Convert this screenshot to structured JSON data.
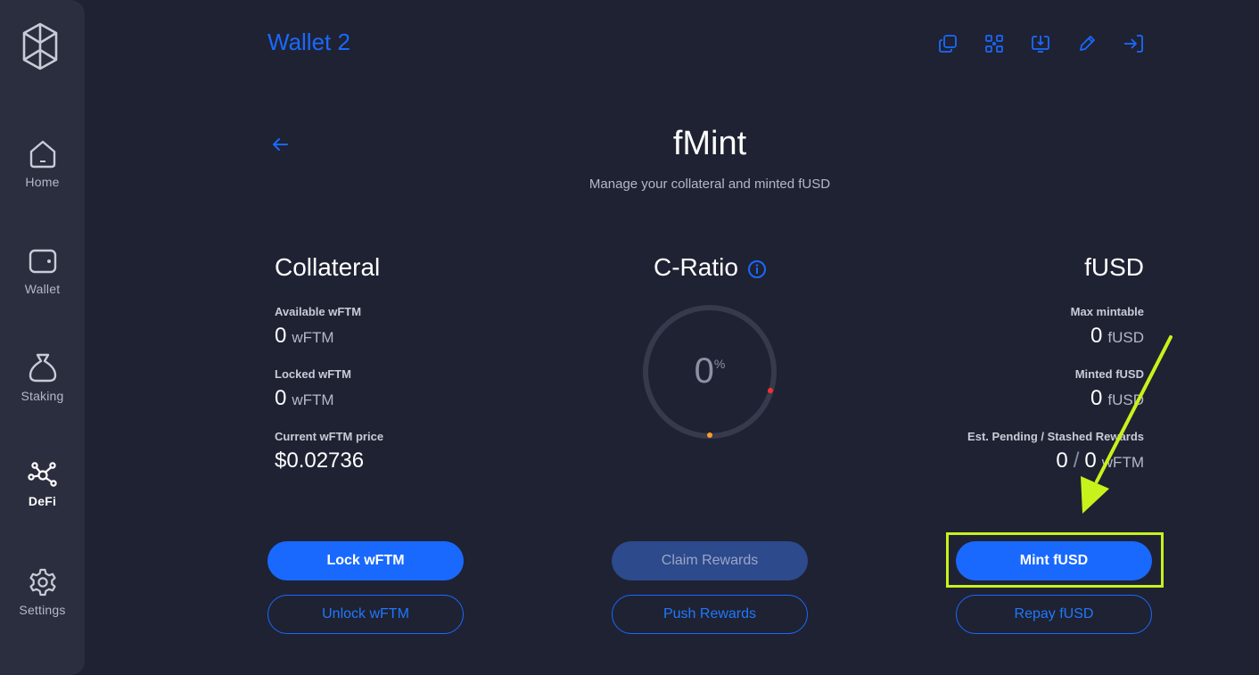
{
  "sidebar": {
    "items": [
      {
        "label": "Home",
        "icon": "home-icon"
      },
      {
        "label": "Wallet",
        "icon": "wallet-icon"
      },
      {
        "label": "Staking",
        "icon": "staking-bag-icon"
      },
      {
        "label": "DeFi",
        "icon": "defi-network-icon",
        "active": true
      },
      {
        "label": "Settings",
        "icon": "gear-icon"
      }
    ]
  },
  "header": {
    "wallet_title": "Wallet 2",
    "icons": [
      "copy-icon",
      "qr-code-icon",
      "receive-icon",
      "edit-icon",
      "logout-icon"
    ]
  },
  "page": {
    "title": "fMint",
    "subtitle": "Manage your collateral and minted fUSD"
  },
  "collateral": {
    "heading": "Collateral",
    "available_label": "Available wFTM",
    "available_value": "0",
    "available_unit": "wFTM",
    "locked_label": "Locked wFTM",
    "locked_value": "0",
    "locked_unit": "wFTM",
    "price_label": "Current wFTM price",
    "price_value": "$0.02736"
  },
  "ratio": {
    "heading": "C-Ratio",
    "value": "0",
    "unit": "%"
  },
  "fusd": {
    "heading": "fUSD",
    "max_label": "Max mintable",
    "max_value": "0",
    "max_unit": "fUSD",
    "minted_label": "Minted fUSD",
    "minted_value": "0",
    "minted_unit": "fUSD",
    "rewards_label": "Est. Pending / Stashed Rewards",
    "pending_value": "0",
    "separator": "/",
    "stashed_value": "0",
    "rewards_unit": "wFTM"
  },
  "buttons": {
    "lock": "Lock wFTM",
    "unlock": "Unlock wFTM",
    "claim": "Claim Rewards",
    "push": "Push Rewards",
    "mint": "Mint fUSD",
    "repay": "Repay fUSD"
  },
  "colors": {
    "accent": "#1969ff",
    "background": "#1f2232",
    "sidebar": "#2b2e3e",
    "highlight": "#c8f21c"
  }
}
